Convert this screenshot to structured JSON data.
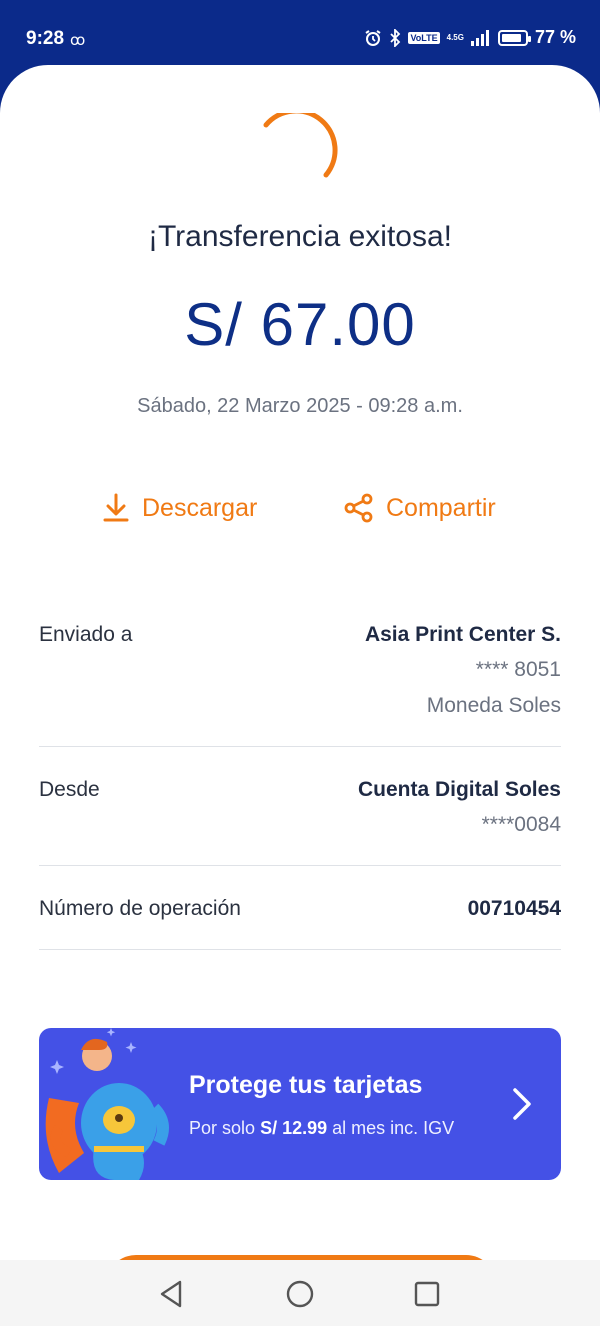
{
  "status_bar": {
    "time": "9:28",
    "voicemail_icon": "voicemail-icon",
    "network": "4.5G",
    "volte": "VoLTE",
    "battery": "77 %"
  },
  "receipt": {
    "title": "¡Transferencia exitosa!",
    "amount": "S/ 67.00",
    "date": "Sábado, 22 Marzo 2025 - 09:28 a.m."
  },
  "actions": {
    "download": {
      "label": "Descargar",
      "icon": "download-icon"
    },
    "share": {
      "label": "Compartir",
      "icon": "share-icon"
    }
  },
  "details": {
    "sent_to": {
      "label": "Enviado a",
      "name": "Asia Print Center S.",
      "account": "**** 8051",
      "currency": "Moneda Soles"
    },
    "from": {
      "label": "Desde",
      "account_name": "Cuenta Digital Soles",
      "account_number": "****0084"
    },
    "operation": {
      "label": "Número de operación",
      "number": "00710454"
    }
  },
  "promo": {
    "title": "Protege tus tarjetas",
    "prefix": "Por solo",
    "price": "S/ 12.99",
    "suffix": "al mes inc. IGV",
    "icon": "chevron-right-icon"
  },
  "colors": {
    "brand_blue": "#0b2a8a",
    "amount_blue": "#0e2f86",
    "accent_orange": "#f07a14",
    "promo_blue": "#4451e6"
  }
}
